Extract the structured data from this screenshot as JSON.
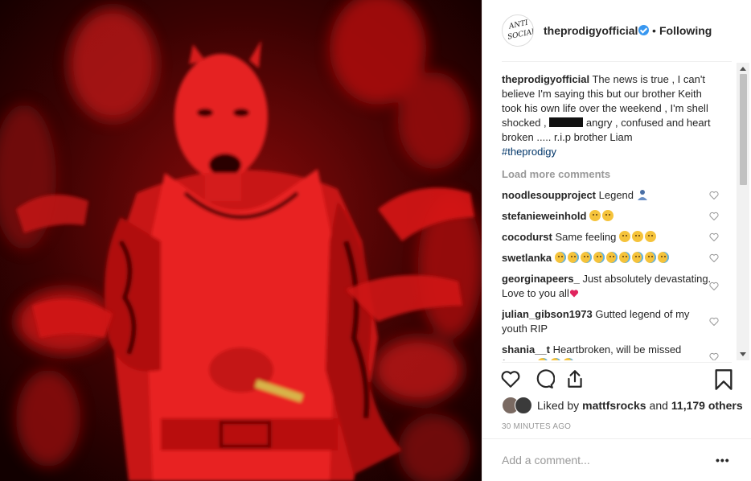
{
  "post": {
    "username": "theprodigyofficial",
    "avatar_text": [
      "ANTI",
      "SOCIAL"
    ],
    "follow_dot": "•",
    "follow_state": "Following",
    "caption_user": "theprodigyofficial",
    "caption_part1": "The news is true , I can't believe I'm saying this but our brother Keith took his own life over the weekend , I'm shell shocked ,",
    "caption_part2": "angry , confused and heart broken ..... r.i.p brother Liam",
    "hashtag": "#theprodigy",
    "load_more": "Load more comments"
  },
  "comments": [
    {
      "user": "noodlesoupproject",
      "text": "Legend",
      "emoji": [
        "person-icon"
      ]
    },
    {
      "user": "stefanieweinhold",
      "text": "",
      "emoji": [
        "frown-face-icon",
        "sad-face-icon"
      ]
    },
    {
      "user": "cocodurst",
      "text": "Same feeling",
      "emoji": [
        "sad-face-icon",
        "sad-face-icon",
        "sad-face-icon"
      ]
    },
    {
      "user": "swetlanka",
      "text": "",
      "emoji": [
        "crying-face-icon",
        "crying-face-icon",
        "crying-face-icon",
        "crying-face-icon",
        "crying-face-icon",
        "crying-face-icon",
        "crying-face-icon",
        "crying-face-icon",
        "crying-face-icon"
      ]
    },
    {
      "user": "georginapeers_",
      "text": "Just absolutely devastating. Love to you all",
      "emoji": [
        "red-heart-icon"
      ]
    },
    {
      "user": "julian_gibson1973",
      "text": "Gutted legend of my youth RIP",
      "emoji": []
    },
    {
      "user": "shania__t",
      "text": "Heartbroken, will be missed forever",
      "emoji": [
        "crying-face-icon",
        "crying-face-icon",
        "crying-face-icon",
        "red-heart-icon",
        "red-heart-icon",
        "red-heart-icon"
      ]
    }
  ],
  "likes": {
    "prefix": "Liked by",
    "user": "mattfsrocks",
    "and": "and",
    "count": "11,179 others"
  },
  "timestamp": "30 MINUTES AGO",
  "add_comment_placeholder": "Add a comment...",
  "more_label": "•••",
  "colors": {
    "link": "#003569",
    "verified": "#3897f0",
    "muted": "#999999",
    "photo_red": "#e01010"
  }
}
